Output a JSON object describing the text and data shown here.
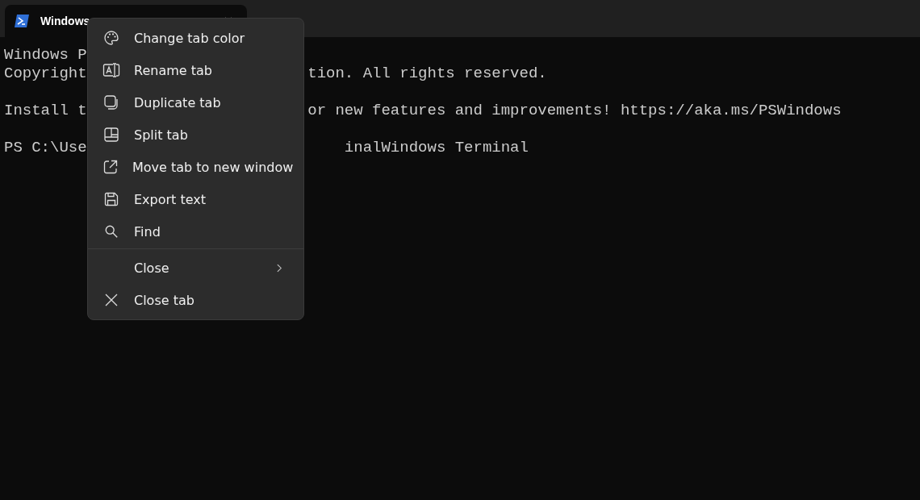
{
  "tabs": [
    {
      "title": "Windows",
      "selected": true
    }
  ],
  "terminal": {
    "blocks": [
      [
        {
          "left": "Windows P"
        },
        {
          "left": "Copyright",
          "right": "tion. All rights reserved."
        }
      ],
      [
        {
          "left": "Install t",
          "right": "or new features and improvements! https://aka.ms/PSWindows"
        }
      ],
      [
        {
          "left": "PS C:\\Use",
          "right": "inalWindows Terminal"
        }
      ]
    ]
  },
  "context_menu": {
    "items": [
      {
        "kind": "palette",
        "label": "Change tab color"
      },
      {
        "kind": "rename",
        "label": "Rename tab"
      },
      {
        "kind": "duplicate",
        "label": "Duplicate tab"
      },
      {
        "kind": "split",
        "label": "Split tab"
      },
      {
        "kind": "external",
        "label": "Move tab to new window"
      },
      {
        "kind": "save",
        "label": "Export text"
      },
      {
        "kind": "search",
        "label": "Find"
      },
      {
        "kind": "submenu",
        "label": "Close"
      },
      {
        "kind": "close",
        "label": "Close tab"
      }
    ]
  }
}
